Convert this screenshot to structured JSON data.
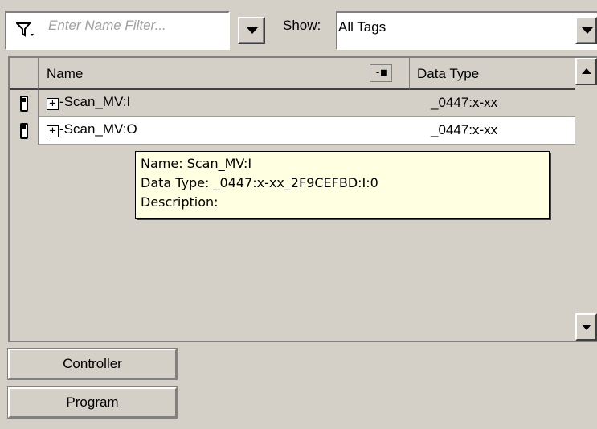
{
  "filter": {
    "placeholder": "Enter Name Filter..."
  },
  "show": {
    "label": "Show:",
    "value": "All Tags"
  },
  "grid": {
    "columns": [
      "Name",
      "Data Type"
    ],
    "column_button": "-■",
    "rows": [
      {
        "name": "Scan_MV:I",
        "data_type": "_0447:x-xx"
      },
      {
        "name": "Scan_MV:O",
        "data_type": "_0447:x-xx"
      }
    ]
  },
  "tooltip": {
    "line1": "Name: Scan_MV:I",
    "line2": "Data Type: _0447:x-xx_2F9CEFBD:I:0",
    "line3": "Description:"
  },
  "scope_buttons": {
    "controller": "Controller",
    "program": "Program"
  },
  "colors": {
    "window_bg": "#d4d0c8",
    "tooltip_bg": "#ffffe1",
    "row_bg": "#ffffff"
  },
  "icons": [
    "funnel-filter-icon",
    "chevron-down-icon",
    "tag-icon",
    "expand-plus-icon",
    "arrow-up-icon",
    "arrow-down-icon"
  ]
}
